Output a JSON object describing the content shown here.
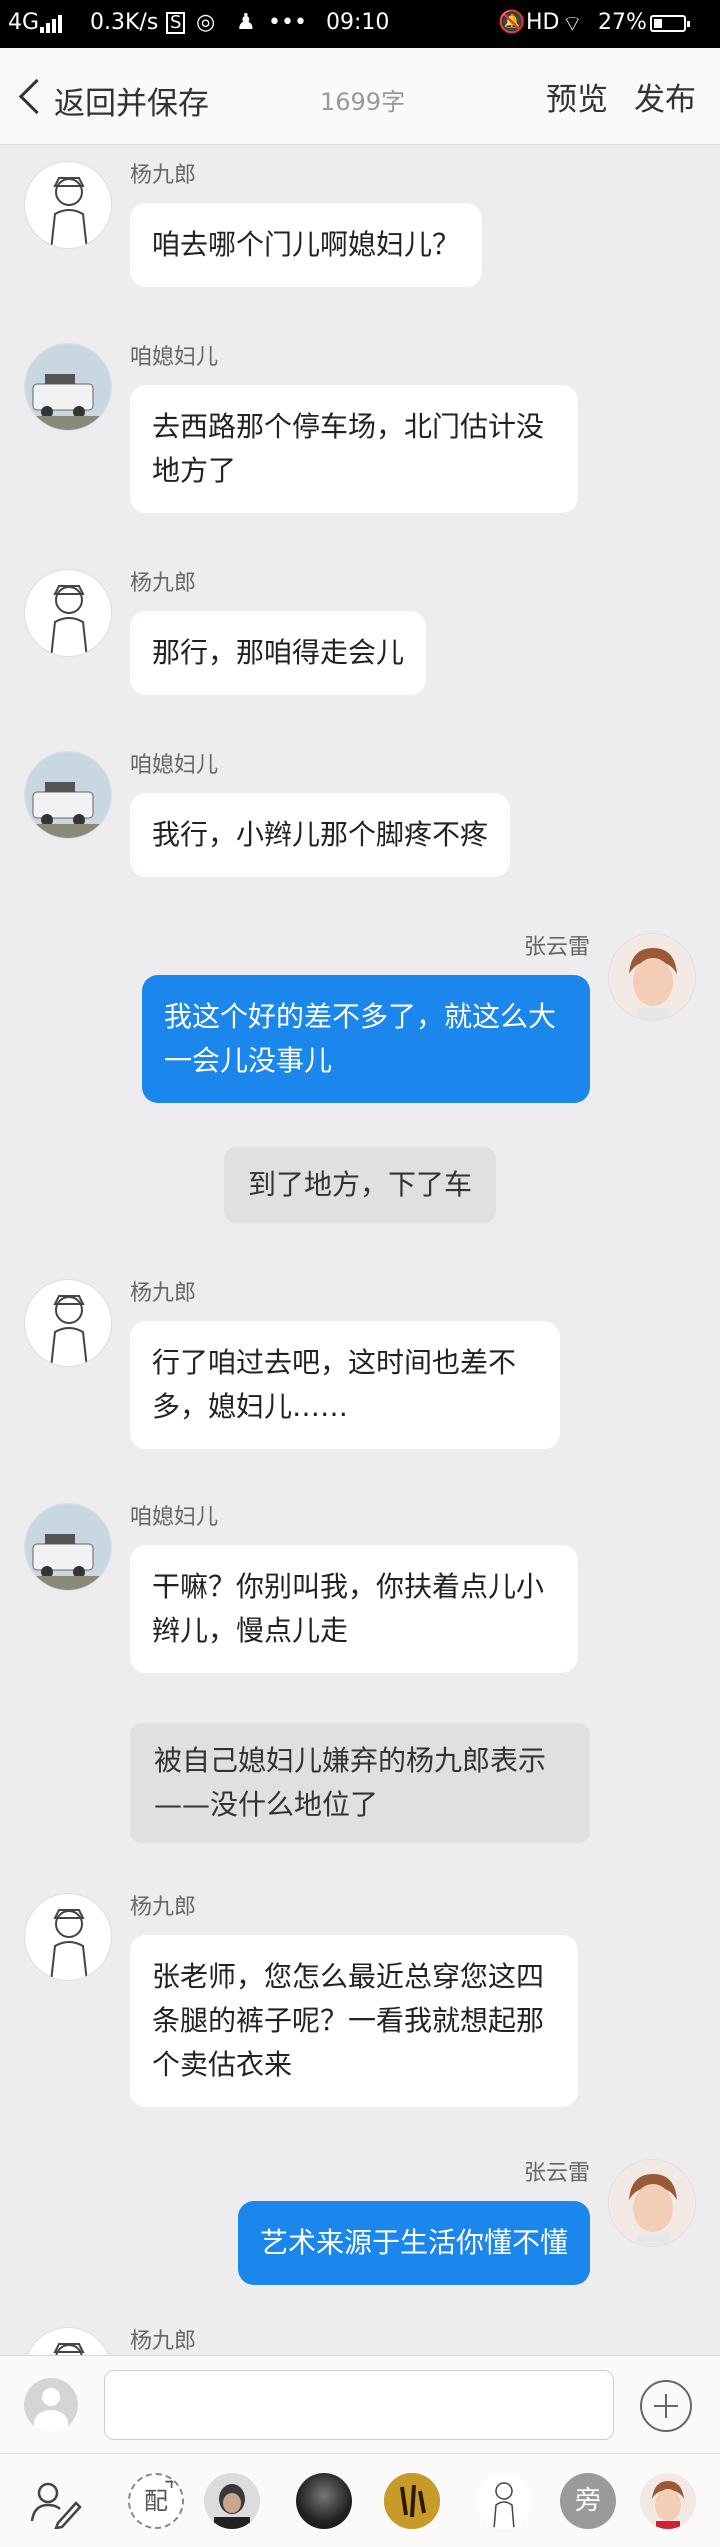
{
  "status_bar": {
    "network": "4G",
    "speed": "0.3K/s",
    "time": "09:10",
    "hd": "HD",
    "battery": "27%"
  },
  "nav": {
    "back_label": "返回并保存",
    "word_count": "1699字",
    "preview": "预览",
    "publish": "发布"
  },
  "messages": [
    {
      "side": "left",
      "name": "杨九郎",
      "text": "咱去哪个门儿啊媳妇儿？",
      "avatar": "sketch"
    },
    {
      "side": "left",
      "name": "咱媳妇儿",
      "text": "去西路那个停车场，北门估计没地方了",
      "avatar": "van"
    },
    {
      "side": "left",
      "name": "杨九郎",
      "text": "那行，那咱得走会儿",
      "avatar": "sketch"
    },
    {
      "side": "left",
      "name": "咱媳妇儿",
      "text": "我行，小辫儿那个脚疼不疼",
      "avatar": "van"
    },
    {
      "side": "right",
      "name": "张云雷",
      "text": "我这个好的差不多了，就这么大一会儿没事儿",
      "avatar": "photo"
    },
    {
      "side": "narration",
      "text": "到了地方，下了车"
    },
    {
      "side": "left",
      "name": "杨九郎",
      "text": "行了咱过去吧，这时间也差不多，媳妇儿……",
      "avatar": "sketch"
    },
    {
      "side": "left",
      "name": "咱媳妇儿",
      "text": "干嘛？你别叫我，你扶着点儿小辫儿，慢点儿走",
      "avatar": "van"
    },
    {
      "side": "narration",
      "text": "被自己媳妇儿嫌弃的杨九郎表示——没什么地位了"
    },
    {
      "side": "left",
      "name": "杨九郎",
      "text": "张老师，您怎么最近总穿您这四条腿的裤子呢？一看我就想起那个卖估衣来",
      "avatar": "sketch"
    },
    {
      "side": "right",
      "name": "张云雷",
      "text": "艺术来源于生活你懂不懂",
      "avatar": "photo"
    },
    {
      "side": "left",
      "name": "杨九郎",
      "text": "",
      "avatar": "sketch"
    }
  ],
  "role_bar": {
    "pei_label": "配",
    "pang_label": "旁"
  },
  "colors": {
    "background": "#efecef",
    "right_bubble": "#1b86ec",
    "left_bubble": "#ffffff",
    "narration": "#e2dfe2"
  }
}
